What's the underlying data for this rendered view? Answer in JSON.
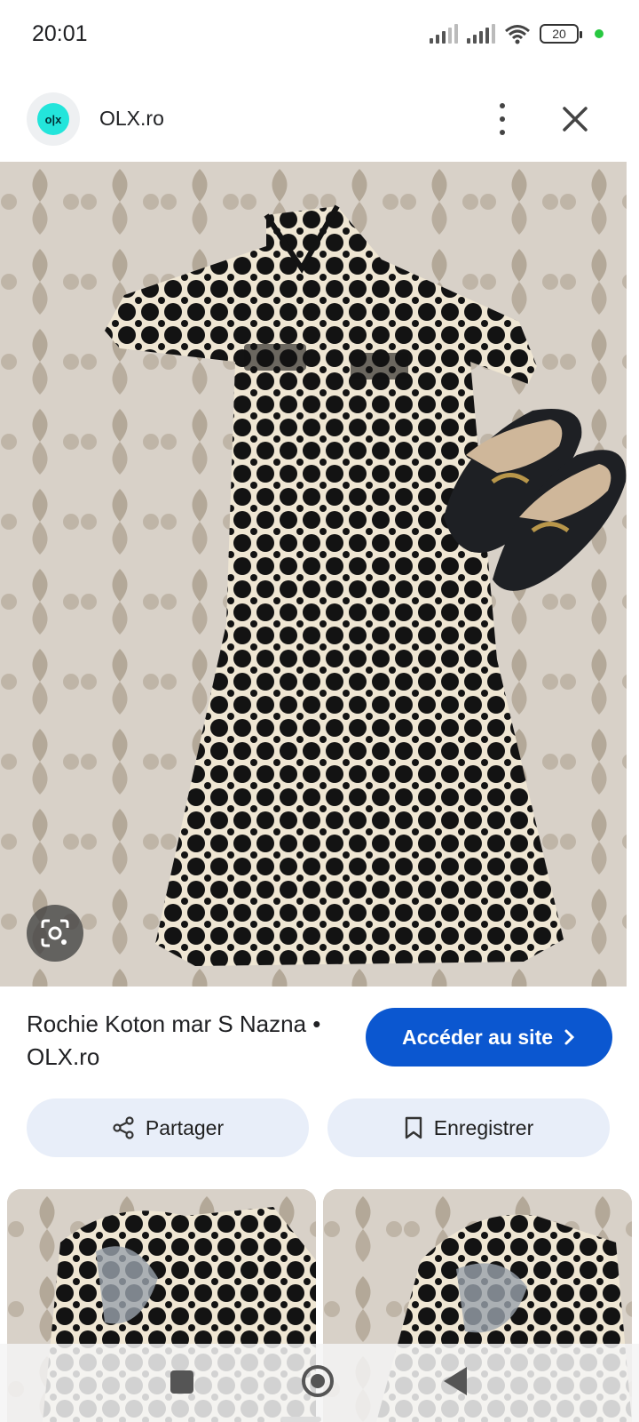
{
  "status_bar": {
    "time": "20:01",
    "battery": "20",
    "icons": [
      "signal-icon",
      "signal-icon",
      "wifi-icon",
      "battery-icon"
    ]
  },
  "header": {
    "logo_text": "o|x",
    "site_name": "OLX.ro",
    "more_icon": "more-vertical-icon",
    "close_icon": "close-icon"
  },
  "result": {
    "title": "Rochie Koton mar S Nazna • OLX.ro",
    "visit_label": "Accéder au site",
    "share_label": "Partager",
    "save_label": "Enregistrer"
  },
  "colors": {
    "accent": "#0b57d0",
    "pill_bg": "#e8eef9",
    "logo_teal": "#23e5db"
  }
}
